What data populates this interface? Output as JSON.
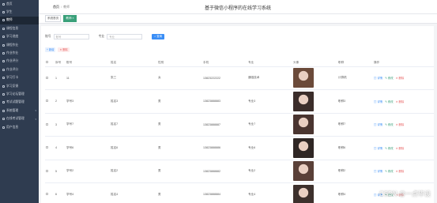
{
  "sidebar": {
    "items": [
      {
        "label": "首页",
        "active": false
      },
      {
        "label": "学生",
        "active": false
      },
      {
        "label": "教师",
        "active": true
      },
      {
        "label": "课程信息",
        "active": false
      },
      {
        "label": "学习进度",
        "active": false
      },
      {
        "label": "课程作业",
        "active": false
      },
      {
        "label": "作业作业",
        "active": false
      },
      {
        "label": "作业评分",
        "active": false
      },
      {
        "label": "作业评分",
        "active": false
      },
      {
        "label": "学习打卡",
        "active": false
      },
      {
        "label": "学习反馈",
        "active": false
      },
      {
        "label": "学习论坛管理",
        "active": false
      },
      {
        "label": "考试试题管理",
        "active": false
      },
      {
        "label": "系统管理",
        "active": false,
        "arrow": "▾"
      },
      {
        "label": "在线考试管理",
        "active": false,
        "arrow": "▾"
      },
      {
        "label": "用户信息",
        "active": false
      }
    ]
  },
  "header": {
    "crumb_home": "首页",
    "crumb_current": "教师",
    "title": "基于微信小程序的在线学习系统"
  },
  "tags": {
    "t1": "系统首页",
    "t2": "教师 ×"
  },
  "filter": {
    "label1": "账号",
    "placeholder1": "账号",
    "label2": "专业",
    "placeholder2": "专业",
    "search": "查询"
  },
  "actions": {
    "add": "新增",
    "delete": "删除"
  },
  "table": {
    "headers": [
      "",
      "序号",
      "账号",
      "姓名",
      "性别",
      "手机",
      "专业",
      "头像",
      "职称",
      "操作"
    ],
    "rows": [
      {
        "no": "1",
        "account": "11",
        "name": "张三",
        "gender": "女",
        "phone": "13823222222",
        "major": "通信技术",
        "title": "计算机"
      },
      {
        "no": "2",
        "account": "学号3",
        "name": "姓名3",
        "gender": "男",
        "phone": "13823888883",
        "major": "专业3",
        "title": "职称3"
      },
      {
        "no": "3",
        "account": "学号7",
        "name": "姓名7",
        "gender": "男",
        "phone": "13823888887",
        "major": "专业7",
        "title": "职称7"
      },
      {
        "no": "4",
        "account": "学号6",
        "name": "姓名6",
        "gender": "男",
        "phone": "13823888886",
        "major": "专业6",
        "title": "职称6"
      },
      {
        "no": "5",
        "account": "学号2",
        "name": "姓名2",
        "gender": "男",
        "phone": "13823888882",
        "major": "专业2",
        "title": "职称2"
      },
      {
        "no": "6",
        "account": "学号4",
        "name": "姓名4",
        "gender": "男",
        "phone": "13823888884",
        "major": "专业4",
        "title": "职称4"
      }
    ],
    "ops": {
      "detail": "详情",
      "edit": "修改",
      "delete": "删除"
    }
  },
  "watermark": "CSDN @一点毕设"
}
